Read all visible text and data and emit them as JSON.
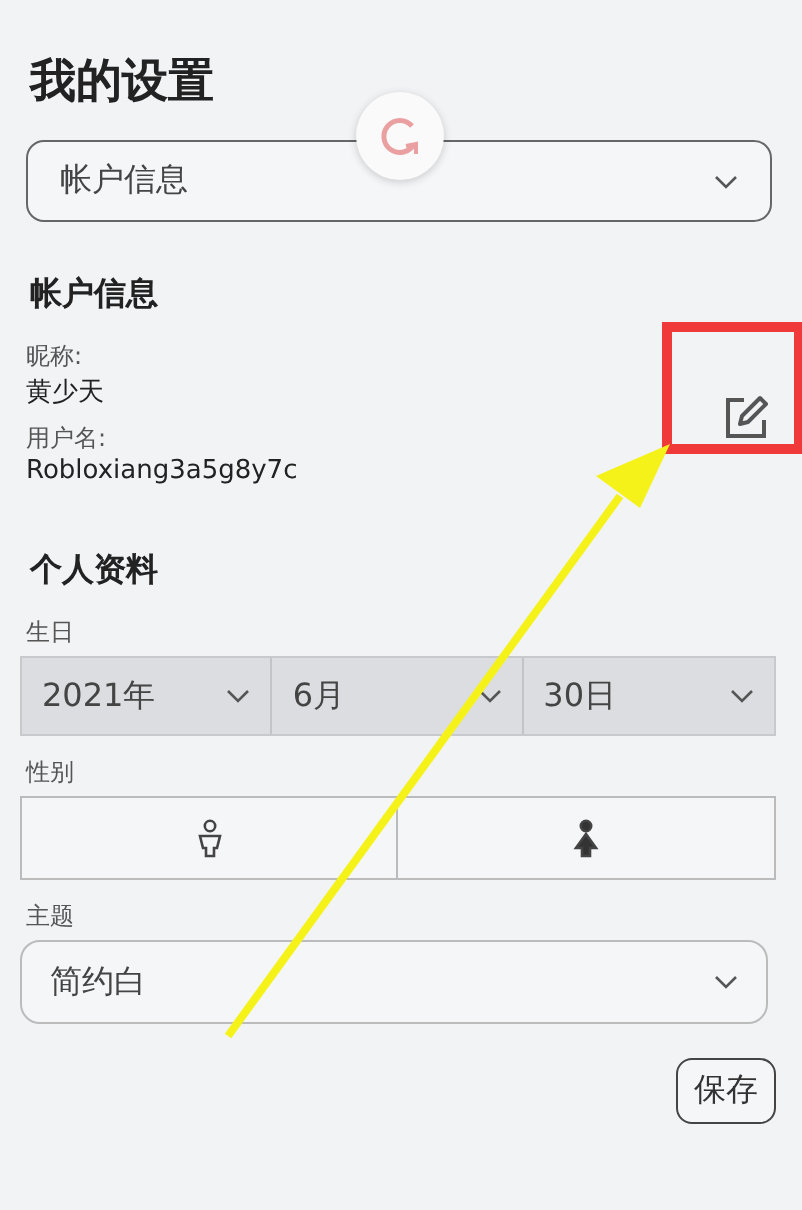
{
  "title": "我的设置",
  "section_select": {
    "value": "帐户信息"
  },
  "account": {
    "heading": "帐户信息",
    "nickname_label": "昵称:",
    "nickname": "黄少天",
    "username_label": "用户名:",
    "username": "Robloxiang3a5g8y7c"
  },
  "profile": {
    "heading": "个人资料",
    "birthday_label": "生日",
    "birthday": [
      {
        "value": "2021年"
      },
      {
        "value": "6月"
      },
      {
        "value": "30日"
      }
    ],
    "gender_label": "性别",
    "gender_options": [
      {
        "kind": "male",
        "selected": false
      },
      {
        "kind": "female",
        "selected": true
      }
    ],
    "theme_label": "主题",
    "theme": {
      "value": "简约白"
    }
  },
  "save_button": "保存"
}
